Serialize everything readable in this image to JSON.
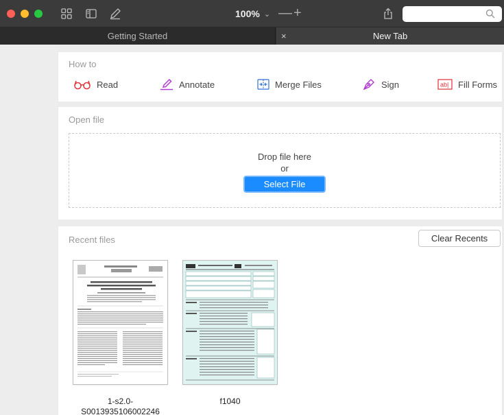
{
  "toolbar": {
    "zoom_value": "100%",
    "zoom_chevron": "⌄",
    "zoom_out": "—",
    "zoom_in": "+",
    "search_placeholder": "",
    "icons": [
      "grid-view-icon",
      "sidebar-toggle-icon",
      "pen-icon",
      "share-icon",
      "search-icon"
    ]
  },
  "tabs": [
    {
      "label": "Getting Started",
      "active": false
    },
    {
      "label": "New Tab",
      "active": true,
      "close": "×"
    }
  ],
  "howto": {
    "label": "How to",
    "items": [
      {
        "label": "Read",
        "icon": "glasses-icon"
      },
      {
        "label": "Annotate",
        "icon": "highlighter-icon"
      },
      {
        "label": "Merge Files",
        "icon": "merge-icon"
      },
      {
        "label": "Sign",
        "icon": "pen-nib-icon"
      },
      {
        "label": "Fill Forms",
        "icon": "form-field-icon"
      }
    ]
  },
  "open_file": {
    "label": "Open file",
    "drop_text": "Drop file here",
    "or_text": "or",
    "select_button": "Select File"
  },
  "recent": {
    "label": "Recent files",
    "clear_button": "Clear Recents",
    "files": [
      {
        "name_line1": "1-s2.0-",
        "name_line2": "S0013935106002246"
      },
      {
        "name_line1": "f1040",
        "name_line2": ""
      }
    ]
  },
  "colors": {
    "accent": "#1a8cff",
    "howto_icon": "#e0303a",
    "annotate_icon": "#b03bd0",
    "merge_icon": "#2f6fd6"
  }
}
